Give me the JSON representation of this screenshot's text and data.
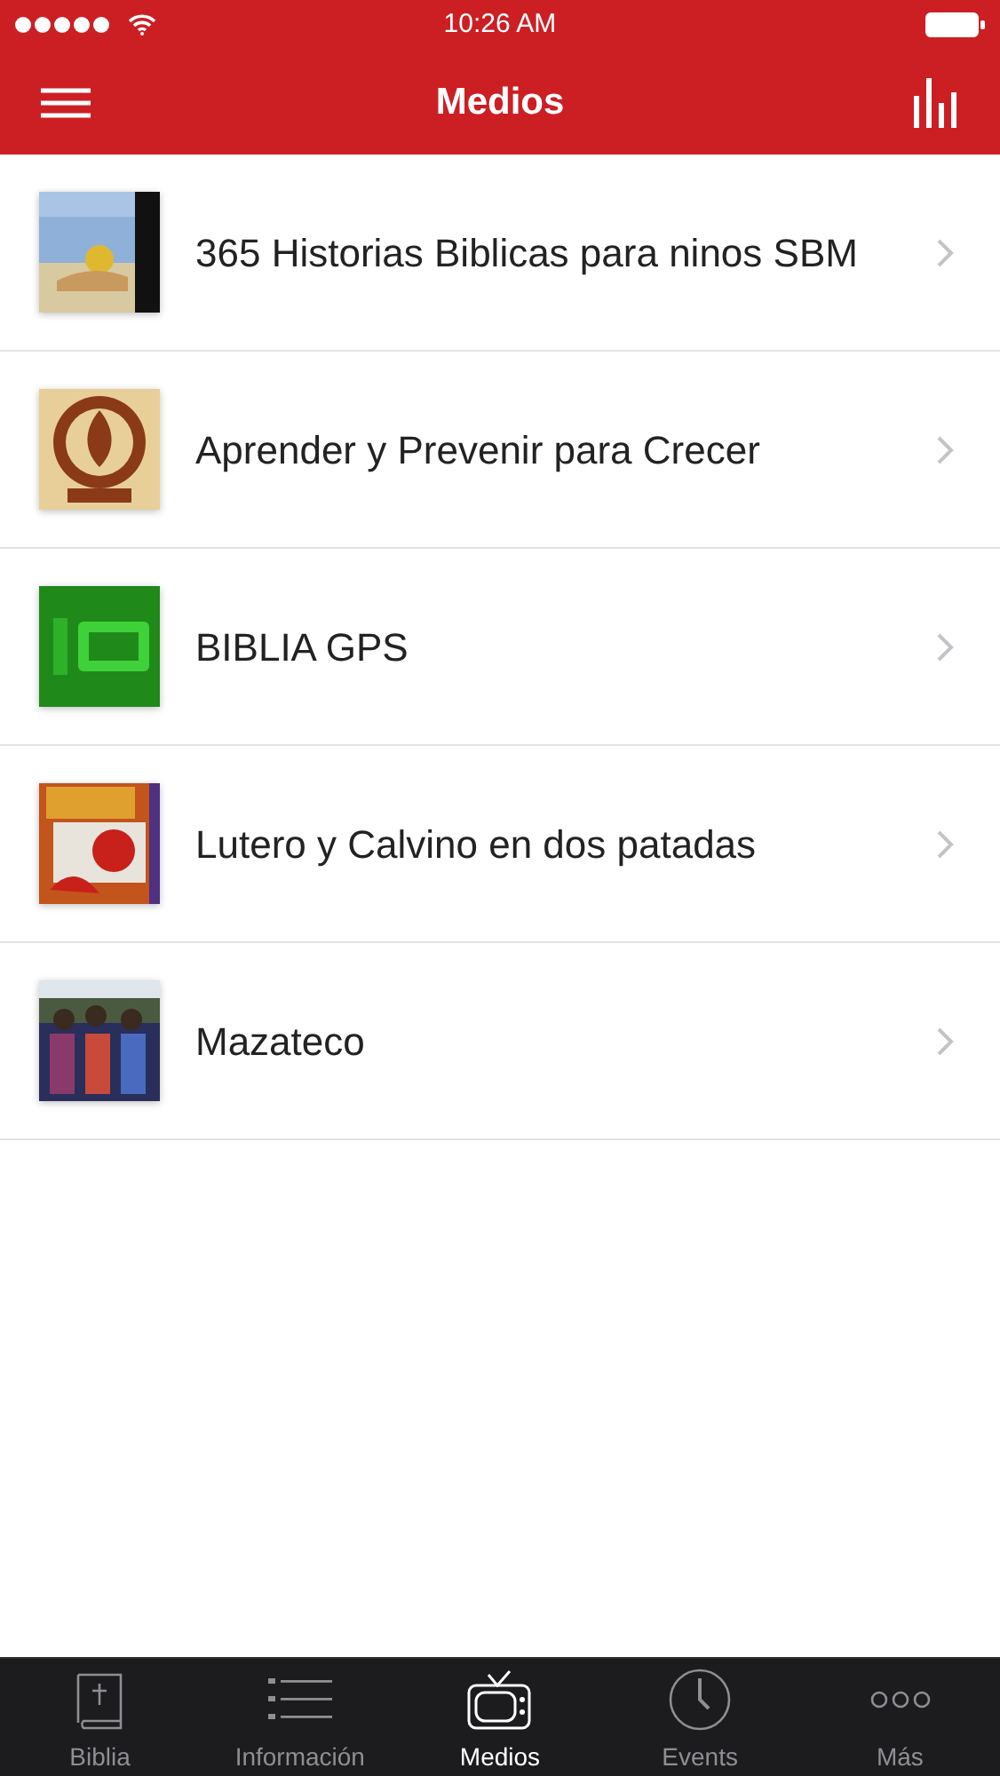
{
  "status_bar": {
    "time": "10:26 AM"
  },
  "nav_bar": {
    "title": "Medios"
  },
  "items": [
    {
      "title": "365 Historias Biblicas para ninos SBM"
    },
    {
      "title": "Aprender y Prevenir para Crecer"
    },
    {
      "title": "BIBLIA GPS"
    },
    {
      "title": "Lutero y Calvino en dos patadas"
    },
    {
      "title": "Mazateco"
    }
  ],
  "tab_bar": [
    {
      "label": "Biblia",
      "selected": false
    },
    {
      "label": "Información",
      "selected": false
    },
    {
      "label": "Medios",
      "selected": true
    },
    {
      "label": "Events",
      "selected": false
    },
    {
      "label": "Más",
      "selected": false
    }
  ]
}
